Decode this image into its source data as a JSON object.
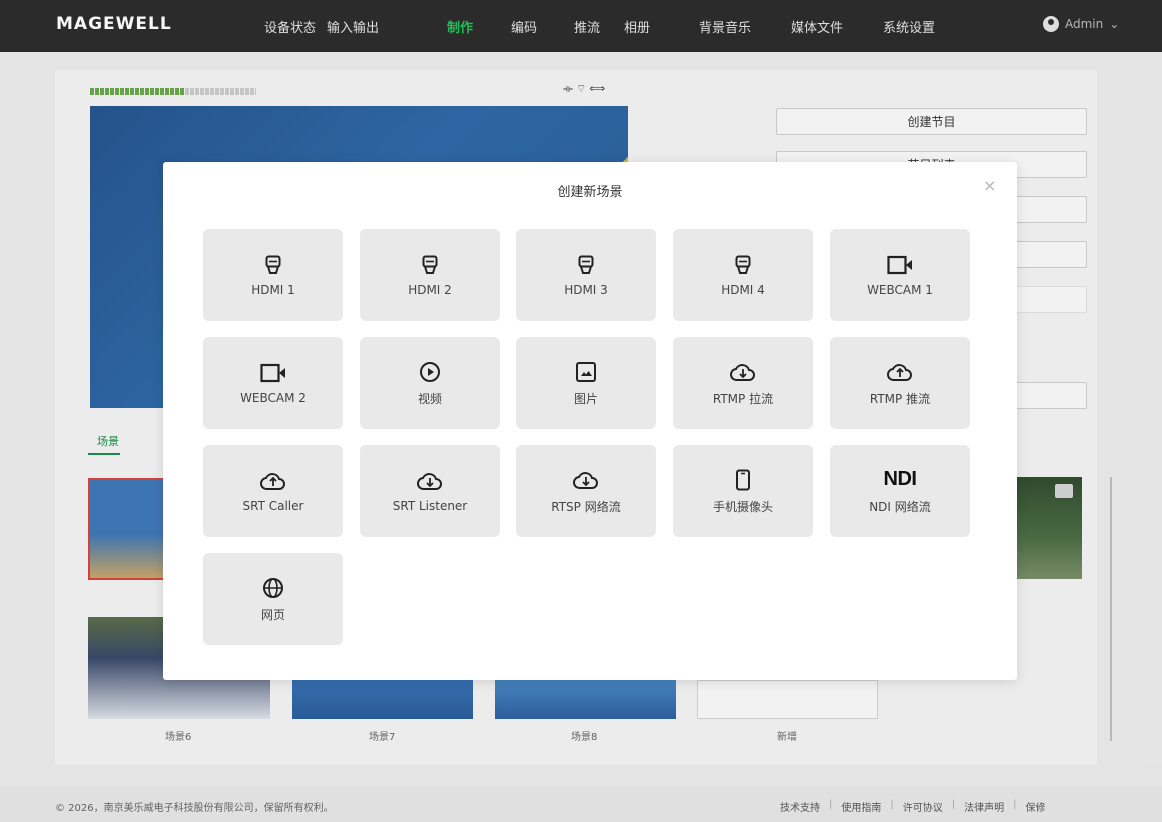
{
  "app": {
    "logo": "MAGEWELL",
    "nav": [
      {
        "label": "设备状态"
      },
      {
        "label": "输入输出"
      },
      {
        "label": "制作"
      },
      {
        "label": "编码"
      },
      {
        "label": "推流"
      },
      {
        "label": "相册"
      },
      {
        "label": "背景音乐"
      },
      {
        "label": "媒体文件"
      },
      {
        "label": "系统设置"
      }
    ],
    "active_nav": "制作",
    "user": "Admin",
    "accent_color": "#22c55e"
  },
  "background": {
    "side_buttons": [
      {
        "label": "创建节目"
      },
      {
        "label": "节目列表"
      }
    ],
    "scene_tab": "场景",
    "scene_labels": [
      "场景6",
      "场景7",
      "场景8",
      "新增"
    ]
  },
  "modal": {
    "title": "创建新场景",
    "close": "×",
    "sources": [
      {
        "label": "HDMI 1",
        "icon": "hdmi-icon"
      },
      {
        "label": "HDMI 2",
        "icon": "hdmi-icon"
      },
      {
        "label": "HDMI 3",
        "icon": "hdmi-icon"
      },
      {
        "label": "HDMI 4",
        "icon": "hdmi-icon"
      },
      {
        "label": "WEBCAM 1",
        "icon": "camera-icon"
      },
      {
        "label": "WEBCAM 2",
        "icon": "camera-icon"
      },
      {
        "label": "视频",
        "icon": "play-icon"
      },
      {
        "label": "图片",
        "icon": "image-icon"
      },
      {
        "label": "RTMP 拉流",
        "icon": "cloud-download-icon"
      },
      {
        "label": "RTMP 推流",
        "icon": "cloud-upload-icon"
      },
      {
        "label": "SRT Caller",
        "icon": "cloud-upload-icon"
      },
      {
        "label": "SRT Listener",
        "icon": "cloud-download-icon"
      },
      {
        "label": "RTSP 网络流",
        "icon": "cloud-download-icon"
      },
      {
        "label": "手机摄像头",
        "icon": "phone-icon"
      },
      {
        "label": "NDI 网络流",
        "icon": "ndi-icon",
        "icon_text": "NDI"
      },
      {
        "label": "网页",
        "icon": "globe-icon"
      }
    ]
  },
  "footer": {
    "copyright": "© 2026，南京美乐威电子科技股份有限公司，保留所有权利。",
    "links": [
      "技术支持",
      "使用指南",
      "许可协议",
      "法律声明",
      "保修"
    ]
  }
}
